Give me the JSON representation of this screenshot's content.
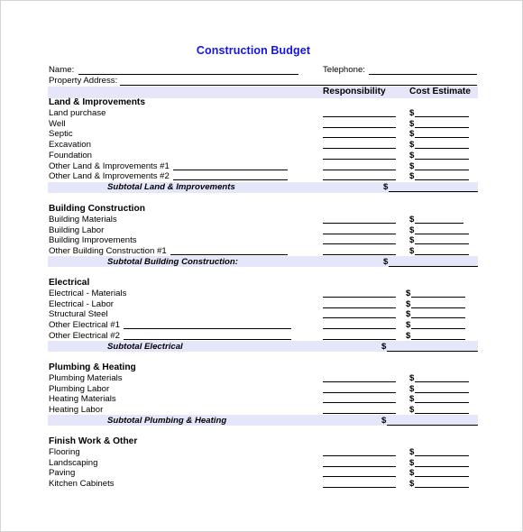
{
  "document": {
    "title": "Construction Budget",
    "name_label": "Name:",
    "telephone_label": "Telephone:",
    "property_address_label": "Property Address:",
    "columns": {
      "responsibility": "Responsibility",
      "cost_estimate": "Cost Estimate"
    },
    "currency_symbol": "$",
    "shade_color": "#e6e6fa",
    "title_color": "#1414e6",
    "sections": [
      {
        "heading": "Land & Improvements",
        "items": [
          {
            "label": "Land purchase",
            "has_blank": false
          },
          {
            "label": "Well",
            "has_blank": false
          },
          {
            "label": "Septic",
            "has_blank": false
          },
          {
            "label": "Excavation",
            "has_blank": false
          },
          {
            "label": "Foundation",
            "has_blank": false
          },
          {
            "label": "Other Land & Improvements #1",
            "has_blank": true
          },
          {
            "label": "Other Land & Improvements #2",
            "has_blank": true
          }
        ],
        "subtotal": "Subtotal Land & Improvements"
      },
      {
        "heading": "Building Construction",
        "items": [
          {
            "label": "Building Materials",
            "has_blank": false
          },
          {
            "label": "Building Labor",
            "has_blank": false
          },
          {
            "label": "Building Improvements",
            "has_blank": false
          },
          {
            "label": "Other Building Construction #1",
            "has_blank": true
          }
        ],
        "subtotal": "Subtotal Building Construction:"
      },
      {
        "heading": "Electrical",
        "items": [
          {
            "label": "Electrical - Materials",
            "has_blank": false
          },
          {
            "label": "Electrical - Labor",
            "has_blank": false
          },
          {
            "label": "Structural Steel",
            "has_blank": false
          },
          {
            "label": "Other Electrical #1",
            "has_blank": true
          },
          {
            "label": "Other Electrical #2",
            "has_blank": true
          }
        ],
        "subtotal": "Subtotal Electrical"
      },
      {
        "heading": "Plumbing & Heating",
        "items": [
          {
            "label": "Plumbing Materials",
            "has_blank": false
          },
          {
            "label": "Plumbing Labor",
            "has_blank": false
          },
          {
            "label": "Heating Materials",
            "has_blank": false
          },
          {
            "label": "Heating Labor",
            "has_blank": false
          }
        ],
        "subtotal": "Subtotal Plumbing & Heating"
      },
      {
        "heading": "Finish Work & Other",
        "items": [
          {
            "label": "Flooring",
            "has_blank": false
          },
          {
            "label": "Landscaping",
            "has_blank": false
          },
          {
            "label": "Paving",
            "has_blank": false
          },
          {
            "label": "Kitchen Cabinets",
            "has_blank": false
          }
        ],
        "subtotal": null
      }
    ]
  }
}
